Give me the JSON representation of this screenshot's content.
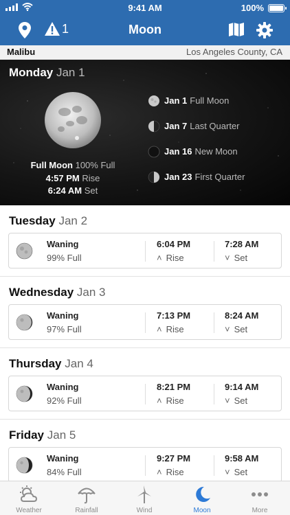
{
  "status": {
    "time": "9:41 AM",
    "battery": "100%"
  },
  "nav": {
    "title": "Moon",
    "alert_count": "1"
  },
  "location": {
    "city": "Malibu",
    "county": "Los Angeles County, CA"
  },
  "today": {
    "day": "Monday",
    "date": "Jan 1",
    "phase_name": "Full Moon",
    "illumination": "100% Full",
    "rise_time": "4:57 PM",
    "rise_label": "Rise",
    "set_time": "6:24 AM",
    "set_label": "Set",
    "upcoming": [
      {
        "date": "Jan 1",
        "name": "Full Moon",
        "icon": "full-moon-icon"
      },
      {
        "date": "Jan 7",
        "name": "Last Quarter",
        "icon": "last-quarter-icon"
      },
      {
        "date": "Jan 16",
        "name": "New Moon",
        "icon": "new-moon-icon"
      },
      {
        "date": "Jan 23",
        "name": "First Quarter",
        "icon": "first-quarter-icon"
      }
    ]
  },
  "days": [
    {
      "day": "Tuesday",
      "date": "Jan 2",
      "phase": "Waning",
      "illumination": "99% Full",
      "rise": "6:04 PM",
      "rise_label": "Rise",
      "set": "7:28 AM",
      "set_label": "Set"
    },
    {
      "day": "Wednesday",
      "date": "Jan 3",
      "phase": "Waning",
      "illumination": "97% Full",
      "rise": "7:13 PM",
      "rise_label": "Rise",
      "set": "8:24 AM",
      "set_label": "Set"
    },
    {
      "day": "Thursday",
      "date": "Jan 4",
      "phase": "Waning",
      "illumination": "92% Full",
      "rise": "8:21 PM",
      "rise_label": "Rise",
      "set": "9:14 AM",
      "set_label": "Set"
    },
    {
      "day": "Friday",
      "date": "Jan 5",
      "phase": "Waning",
      "illumination": "84% Full",
      "rise": "9:27 PM",
      "rise_label": "Rise",
      "set": "9:58 AM",
      "set_label": "Set"
    }
  ],
  "tabs": [
    {
      "label": "Weather",
      "icon": "weather-icon"
    },
    {
      "label": "Rainfall",
      "icon": "umbrella-icon"
    },
    {
      "label": "Wind",
      "icon": "wind-turbine-icon"
    },
    {
      "label": "Moon",
      "icon": "moon-icon",
      "active": true
    },
    {
      "label": "More",
      "icon": "more-dots-icon"
    }
  ],
  "colors": {
    "brand": "#2d6cb0",
    "tab_active": "#2d7ad6",
    "tab_inactive": "#8c8c8c"
  }
}
